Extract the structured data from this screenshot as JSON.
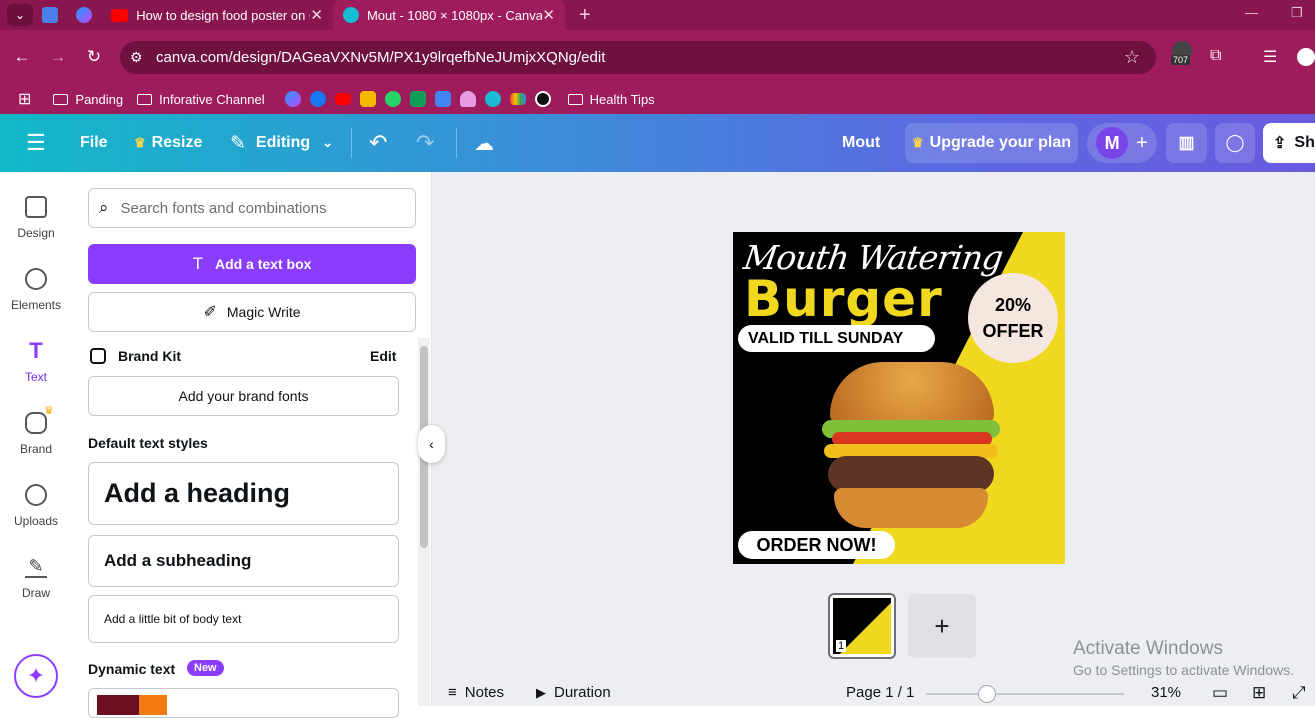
{
  "browser": {
    "tabs": [
      {
        "label": "How to design food poster on C",
        "active": false
      },
      {
        "label": "Mout - 1080 × 1080px - Canva",
        "active": true
      }
    ],
    "url": "canva.com/design/DAGeaVXNv5M/PX1y9lrqefbNeJUmjxXQNg/edit",
    "extension_badge": "707",
    "bookmarks": [
      "Panding",
      "Inforative Channel",
      "Health Tips"
    ]
  },
  "editor": {
    "file": "File",
    "resize": "Resize",
    "editing": "Editing",
    "doc_title": "Mout",
    "upgrade": "Upgrade your plan",
    "avatar": "M",
    "share": "Sh"
  },
  "rail": [
    {
      "label": "Design",
      "icon": "design-icon"
    },
    {
      "label": "Elements",
      "icon": "elements-icon"
    },
    {
      "label": "Text",
      "icon": "text-icon"
    },
    {
      "label": "Brand",
      "icon": "brand-icon"
    },
    {
      "label": "Uploads",
      "icon": "uploads-icon"
    },
    {
      "label": "Draw",
      "icon": "draw-icon"
    }
  ],
  "panel": {
    "search_placeholder": "Search fonts and combinations",
    "add_textbox": "Add a text box",
    "magic_write": "Magic Write",
    "brand_kit": "Brand Kit",
    "brand_edit": "Edit",
    "add_brand_fonts": "Add your brand fonts",
    "default_styles": "Default text styles",
    "heading": "Add a heading",
    "subheading": "Add a subheading",
    "body": "Add a little bit of body text",
    "dynamic_text": "Dynamic text",
    "new_badge": "New"
  },
  "poster": {
    "script_title": "Mouth Watering",
    "title": "Burger",
    "valid": "VALID TILL SUNDAY",
    "offer_line1": "20%",
    "offer_line2": "OFFER",
    "cta": "ORDER NOW!"
  },
  "footer": {
    "notes": "Notes",
    "duration": "Duration",
    "page": "Page 1 / 1",
    "zoom": "31%",
    "zoom_fraction": 0.31,
    "page_thumb_number": "1"
  },
  "watermark": {
    "line1": "Activate Windows",
    "line2": "Go to Settings to activate Windows."
  },
  "colors": {
    "brand_purple": "#8b3dff",
    "browser_magenta": "#9e1b5c",
    "poster_yellow": "#f0d81e"
  }
}
